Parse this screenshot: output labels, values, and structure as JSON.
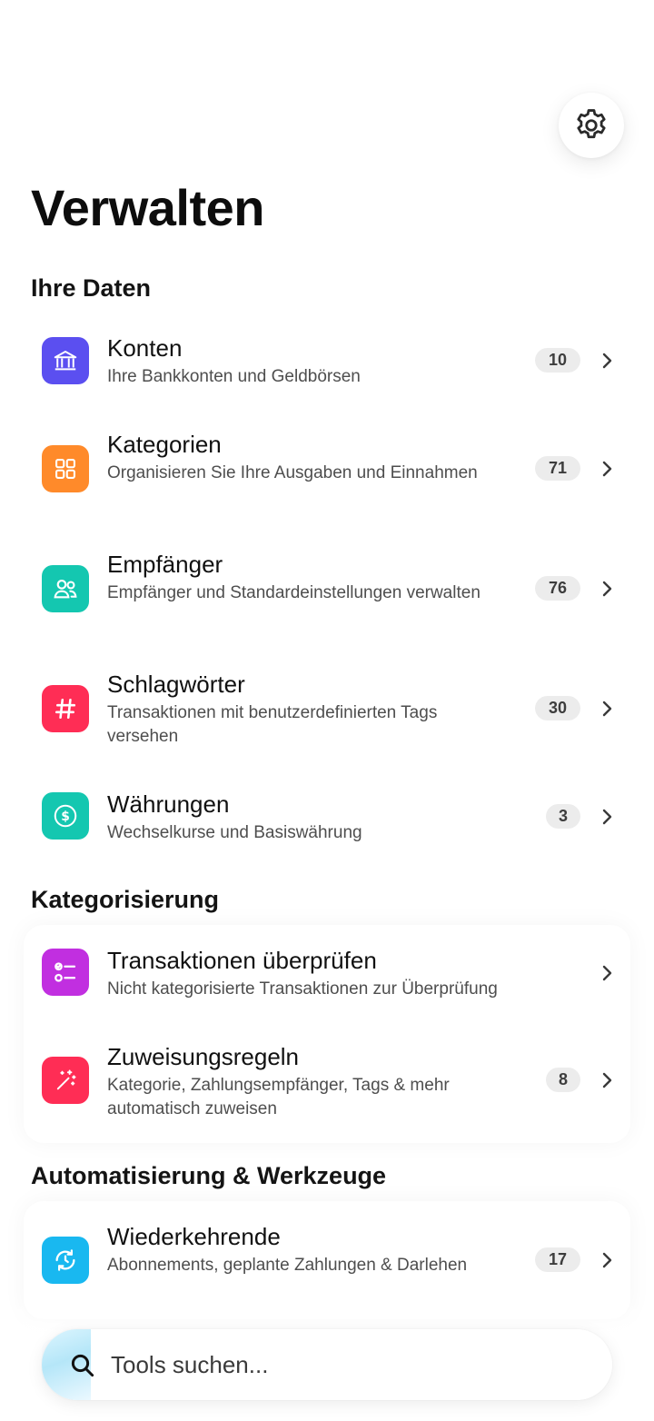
{
  "header": {
    "title": "Verwalten",
    "settings_icon": "gear-icon"
  },
  "sections": {
    "data": {
      "title": "Ihre Daten",
      "items": [
        {
          "label": "Konten",
          "description": "Ihre Bankkonten und Geldbörsen",
          "count": "10",
          "icon": "bank-icon",
          "color": "#5B4FF0"
        },
        {
          "label": "Kategorien",
          "description": "Organisieren Sie Ihre Ausgaben und Einnahmen",
          "count": "71",
          "icon": "grid-icon",
          "color": "#FF8A2A"
        },
        {
          "label": "Empfänger",
          "description": "Empfänger und Standardeinstellungen verwalten",
          "count": "76",
          "icon": "people-icon",
          "color": "#14C7B0"
        },
        {
          "label": "Schlagwörter",
          "description": "Transaktionen mit benutzerdefinierten Tags versehen",
          "count": "30",
          "icon": "hashtag-icon",
          "color": "#FF2D55"
        },
        {
          "label": "Währungen",
          "description": "Wechselkurse und Basiswährung",
          "count": "3",
          "icon": "currency-icon",
          "color": "#14C7B0"
        }
      ]
    },
    "categorization": {
      "title": "Kategorisierung",
      "items": [
        {
          "label": "Transaktionen überprüfen",
          "description": "Nicht kategorisierte Transaktionen zur Überprüfung",
          "icon": "checklist-icon",
          "color": "#C12FE0"
        },
        {
          "label": "Zuweisungsregeln",
          "description": "Kategorie, Zahlungsempfänger, Tags & mehr automatisch zuweisen",
          "count": "8",
          "icon": "magic-wand-icon",
          "color": "#FF2D55"
        }
      ]
    },
    "automation": {
      "title": "Automatisierung & Werkzeuge",
      "items": [
        {
          "label": "Wiederkehrende",
          "description": "Abonnements, geplante Zahlungen & Darlehen",
          "count": "17",
          "icon": "recurring-icon",
          "color": "#19B8F0"
        }
      ]
    }
  },
  "search": {
    "placeholder": "Tools suchen..."
  }
}
